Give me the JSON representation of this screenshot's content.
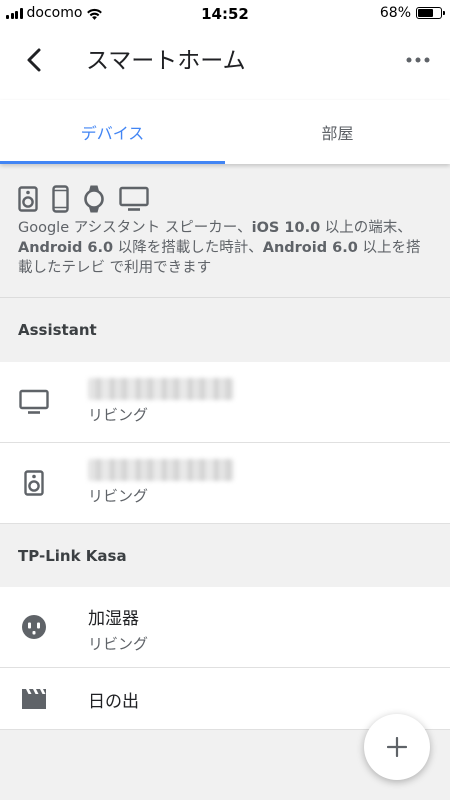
{
  "status_bar": {
    "carrier": "docomo",
    "time": "14:52",
    "battery_percent": "68%",
    "battery_level": 0.68
  },
  "header": {
    "title": "スマートホーム",
    "back_icon": "chevron-left-icon",
    "more_icon": "more-horiz-icon"
  },
  "tabs": [
    {
      "label": "デバイス",
      "active": true
    },
    {
      "label": "部屋",
      "active": false
    }
  ],
  "info": {
    "device_icons": [
      "speaker-icon",
      "phone-icon",
      "watch-icon",
      "tv-icon"
    ],
    "text_parts": {
      "p1": "Google アシスタント スピーカー、",
      "ios": "iOS 10.0",
      "p2": " 以上の端末、",
      "android1": "Android 6.0",
      "p3": " 以降を搭載した時計、",
      "android2": "Android 6.0",
      "p4": " 以上を搭載したテレビ で利用できます"
    }
  },
  "sections": [
    {
      "title": "Assistant",
      "devices": [
        {
          "icon": "tv-icon",
          "name": "",
          "room": "リビング",
          "name_redacted": true
        },
        {
          "icon": "speaker-icon",
          "name": "",
          "room": "リビング",
          "name_redacted": true
        }
      ]
    },
    {
      "title": "TP-Link Kasa",
      "devices": [
        {
          "icon": "outlet-icon",
          "name": "加湿器",
          "room": "リビング",
          "name_redacted": false
        },
        {
          "icon": "scene-clapperboard-icon",
          "name": "日の出",
          "room": "",
          "name_redacted": false
        }
      ]
    }
  ],
  "fab": {
    "icon": "plus-icon"
  },
  "colors": {
    "accent": "#4285f4",
    "icon_gray": "#5f6368",
    "background": "#f1f1f1"
  }
}
